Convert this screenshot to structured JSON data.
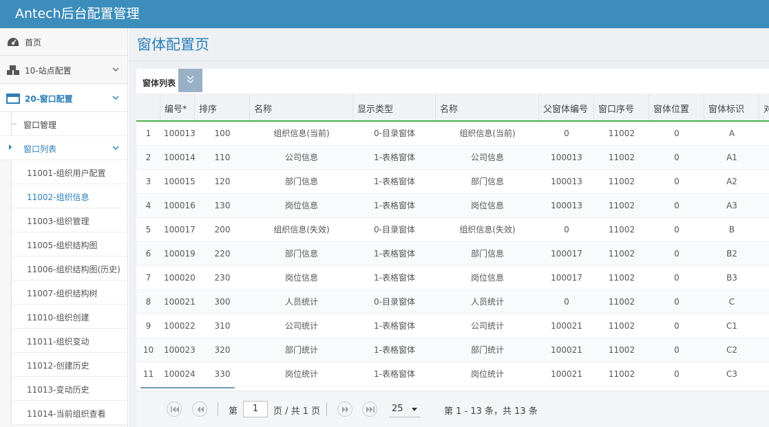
{
  "app": {
    "title": "Antech后台配置管理"
  },
  "sidebar": {
    "items": [
      {
        "label": "首页",
        "icon": "dashboard-icon"
      },
      {
        "label": "10-站点配置",
        "icon": "cubes-icon"
      },
      {
        "label": "20-窗口配置",
        "icon": "window-icon"
      }
    ],
    "window_manage": "窗口管理",
    "window_list": "窗口列表",
    "leaves": [
      "11001-组织用户配置",
      "11002-组织信息",
      "11003-组织管理",
      "11005-组织结构图",
      "11006-组织结构图(历史)",
      "11007-组织结构树",
      "11010-组织创建",
      "11011-组织变动",
      "11012-创建历史",
      "11013-变动历史",
      "11014-当前组织查看"
    ],
    "selected_leaf": "11002-组织信息"
  },
  "main": {
    "page_title": "窗体配置页",
    "tab_label": "窗体列表"
  },
  "grid": {
    "columns": [
      "编号*",
      "排序",
      "名称",
      "显示类型",
      "名称",
      "父窗体编号",
      "窗口序号",
      "窗体位置",
      "窗体标识",
      "对"
    ],
    "rows": [
      {
        "n": "1",
        "id": "100013",
        "sort": "100",
        "name": "组织信息(当前)",
        "type": "0-目录窗体",
        "name2": "组织信息(当前)",
        "parent": "0",
        "win": "11002",
        "pos": "0",
        "tag": "A"
      },
      {
        "n": "2",
        "id": "100014",
        "sort": "110",
        "name": "公司信息",
        "type": "1-表格窗体",
        "name2": "公司信息",
        "parent": "100013",
        "win": "11002",
        "pos": "0",
        "tag": "A1"
      },
      {
        "n": "3",
        "id": "100015",
        "sort": "120",
        "name": "部门信息",
        "type": "1-表格窗体",
        "name2": "部门信息",
        "parent": "100013",
        "win": "11002",
        "pos": "0",
        "tag": "A2"
      },
      {
        "n": "4",
        "id": "100016",
        "sort": "130",
        "name": "岗位信息",
        "type": "1-表格窗体",
        "name2": "岗位信息",
        "parent": "100013",
        "win": "11002",
        "pos": "0",
        "tag": "A3"
      },
      {
        "n": "5",
        "id": "100017",
        "sort": "200",
        "name": "组织信息(失效)",
        "type": "0-目录窗体",
        "name2": "组织信息(失效)",
        "parent": "0",
        "win": "11002",
        "pos": "0",
        "tag": "B"
      },
      {
        "n": "6",
        "id": "100019",
        "sort": "220",
        "name": "部门信息",
        "type": "1-表格窗体",
        "name2": "部门信息",
        "parent": "100017",
        "win": "11002",
        "pos": "0",
        "tag": "B2"
      },
      {
        "n": "7",
        "id": "100020",
        "sort": "230",
        "name": "岗位信息",
        "type": "1-表格窗体",
        "name2": "岗位信息",
        "parent": "100017",
        "win": "11002",
        "pos": "0",
        "tag": "B3"
      },
      {
        "n": "8",
        "id": "100021",
        "sort": "300",
        "name": "人员统计",
        "type": "0-目录窗体",
        "name2": "人员统计",
        "parent": "0",
        "win": "11002",
        "pos": "0",
        "tag": "C"
      },
      {
        "n": "9",
        "id": "100022",
        "sort": "310",
        "name": "公司统计",
        "type": "1-表格窗体",
        "name2": "公司统计",
        "parent": "100021",
        "win": "11002",
        "pos": "0",
        "tag": "C1"
      },
      {
        "n": "10",
        "id": "100023",
        "sort": "320",
        "name": "部门统计",
        "type": "1-表格窗体",
        "name2": "部门统计",
        "parent": "100021",
        "win": "11002",
        "pos": "0",
        "tag": "C2"
      },
      {
        "n": "11",
        "id": "100024",
        "sort": "330",
        "name": "岗位统计",
        "type": "1-表格窗体",
        "name2": "岗位统计",
        "parent": "100021",
        "win": "11002",
        "pos": "0",
        "tag": "C3"
      }
    ]
  },
  "pager": {
    "page_prefix": "第",
    "page_value": "1",
    "page_suffix": "页 / 共 1 页",
    "page_size": "25",
    "summary": "第 1 - 13 条，共 13 条"
  }
}
